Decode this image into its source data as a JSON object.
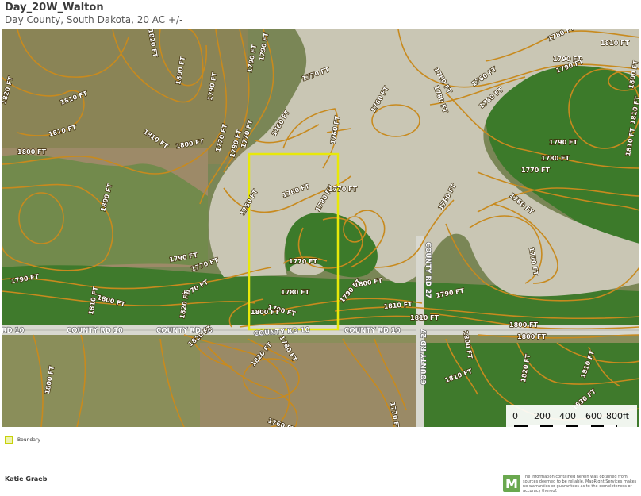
{
  "header": {
    "title": "Day_20W_Walton",
    "subtitle": "Day County, South Dakota, 20 AC +/-"
  },
  "map": {
    "roads": {
      "r1": "RD 10",
      "r2": "COUNTY RD 10",
      "r3": "COUNTY RD 10",
      "r4": "COUNTY RD 10",
      "r5": "COUNTY RD 10",
      "r6": "COUNTY RD 27",
      "r7": "COUNTY RD 27"
    },
    "contours": {
      "c01": "1820 FT",
      "c02": "1810 FT",
      "c03": "1810 FT",
      "c04": "1800 FT",
      "c05": "1800 FT",
      "c06": "1820 FT",
      "c07": "1800 FT",
      "c08": "1790 FT",
      "c09": "1790 FT",
      "c10": "1810 FT",
      "c11": "1800 FT",
      "c12": "1770 FT",
      "c13": "1780 FT",
      "c14": "1770 FT",
      "c15": "1760 FT",
      "c16": "1750 FT",
      "c17": "1770 FT",
      "c18": "1760 FT",
      "c19": "1790 FT",
      "c20": "1760 FT",
      "c21": "1780 FT",
      "c22": "1760 FT",
      "c23": "1770 FT",
      "c24": "1780 FT",
      "c25": "1760 FT",
      "c26": "1780 FT",
      "c27": "1790 FT",
      "c28": "1780 FT",
      "c29": "1790 FT",
      "c30": "1810 FT",
      "c31": "1790 FT",
      "c32": "1780 FT",
      "c33": "1800 FT",
      "c34": "1810 FT",
      "c35": "1810 FT",
      "c36": "1770 FT",
      "c37": "1790 FT",
      "c38": "1790 FT",
      "c39": "1800 FT",
      "c40": "1770 FT",
      "c41": "1780 FT",
      "c42": "1770 FT",
      "c43": "1770 FT",
      "c44": "1760 FT",
      "c45": "1760 FT",
      "c46": "1770 FT",
      "c47": "1790 FT",
      "c48": "1800 FT",
      "c49": "1790 FT",
      "c50": "1800 FT",
      "c51": "1810 FT",
      "c52": "1810 FT",
      "c53": "1820 FT",
      "c54": "1800 FT",
      "c55": "1810 FT",
      "c56": "1820 FT",
      "c57": "1820 FT",
      "c58": "1830 FT",
      "c59": "1800 FT",
      "c60": "1810 FT",
      "c61": "1820 FT",
      "c62": "1800 FT",
      "c63": "1810 FT",
      "c64": "1800 FT",
      "c65": "1760 FT",
      "c66": "1790 FT",
      "c67": "1780 FT",
      "c68": "1770 FT",
      "c69": "1760 FT"
    },
    "colors": {
      "water": "#c9c6b4",
      "grass": "#3f7a2c",
      "field": "#7e8a56",
      "tilled": "#9a8464",
      "contour": "#c88a1e",
      "boundary": "#e8e80a",
      "road": "#d8d8d0"
    }
  },
  "scale": {
    "labels": [
      "0",
      "200",
      "400",
      "600",
      "800ft"
    ]
  },
  "legend": {
    "boundary_label": "Boundary"
  },
  "footer": {
    "agent": "Katie Graeb",
    "logo_letter": "M",
    "disclaimer": "The information contained herein was obtained from sources deemed to be reliable. MapRight Services makes no warranties or guarantees as to the completeness or accuracy thereof."
  }
}
